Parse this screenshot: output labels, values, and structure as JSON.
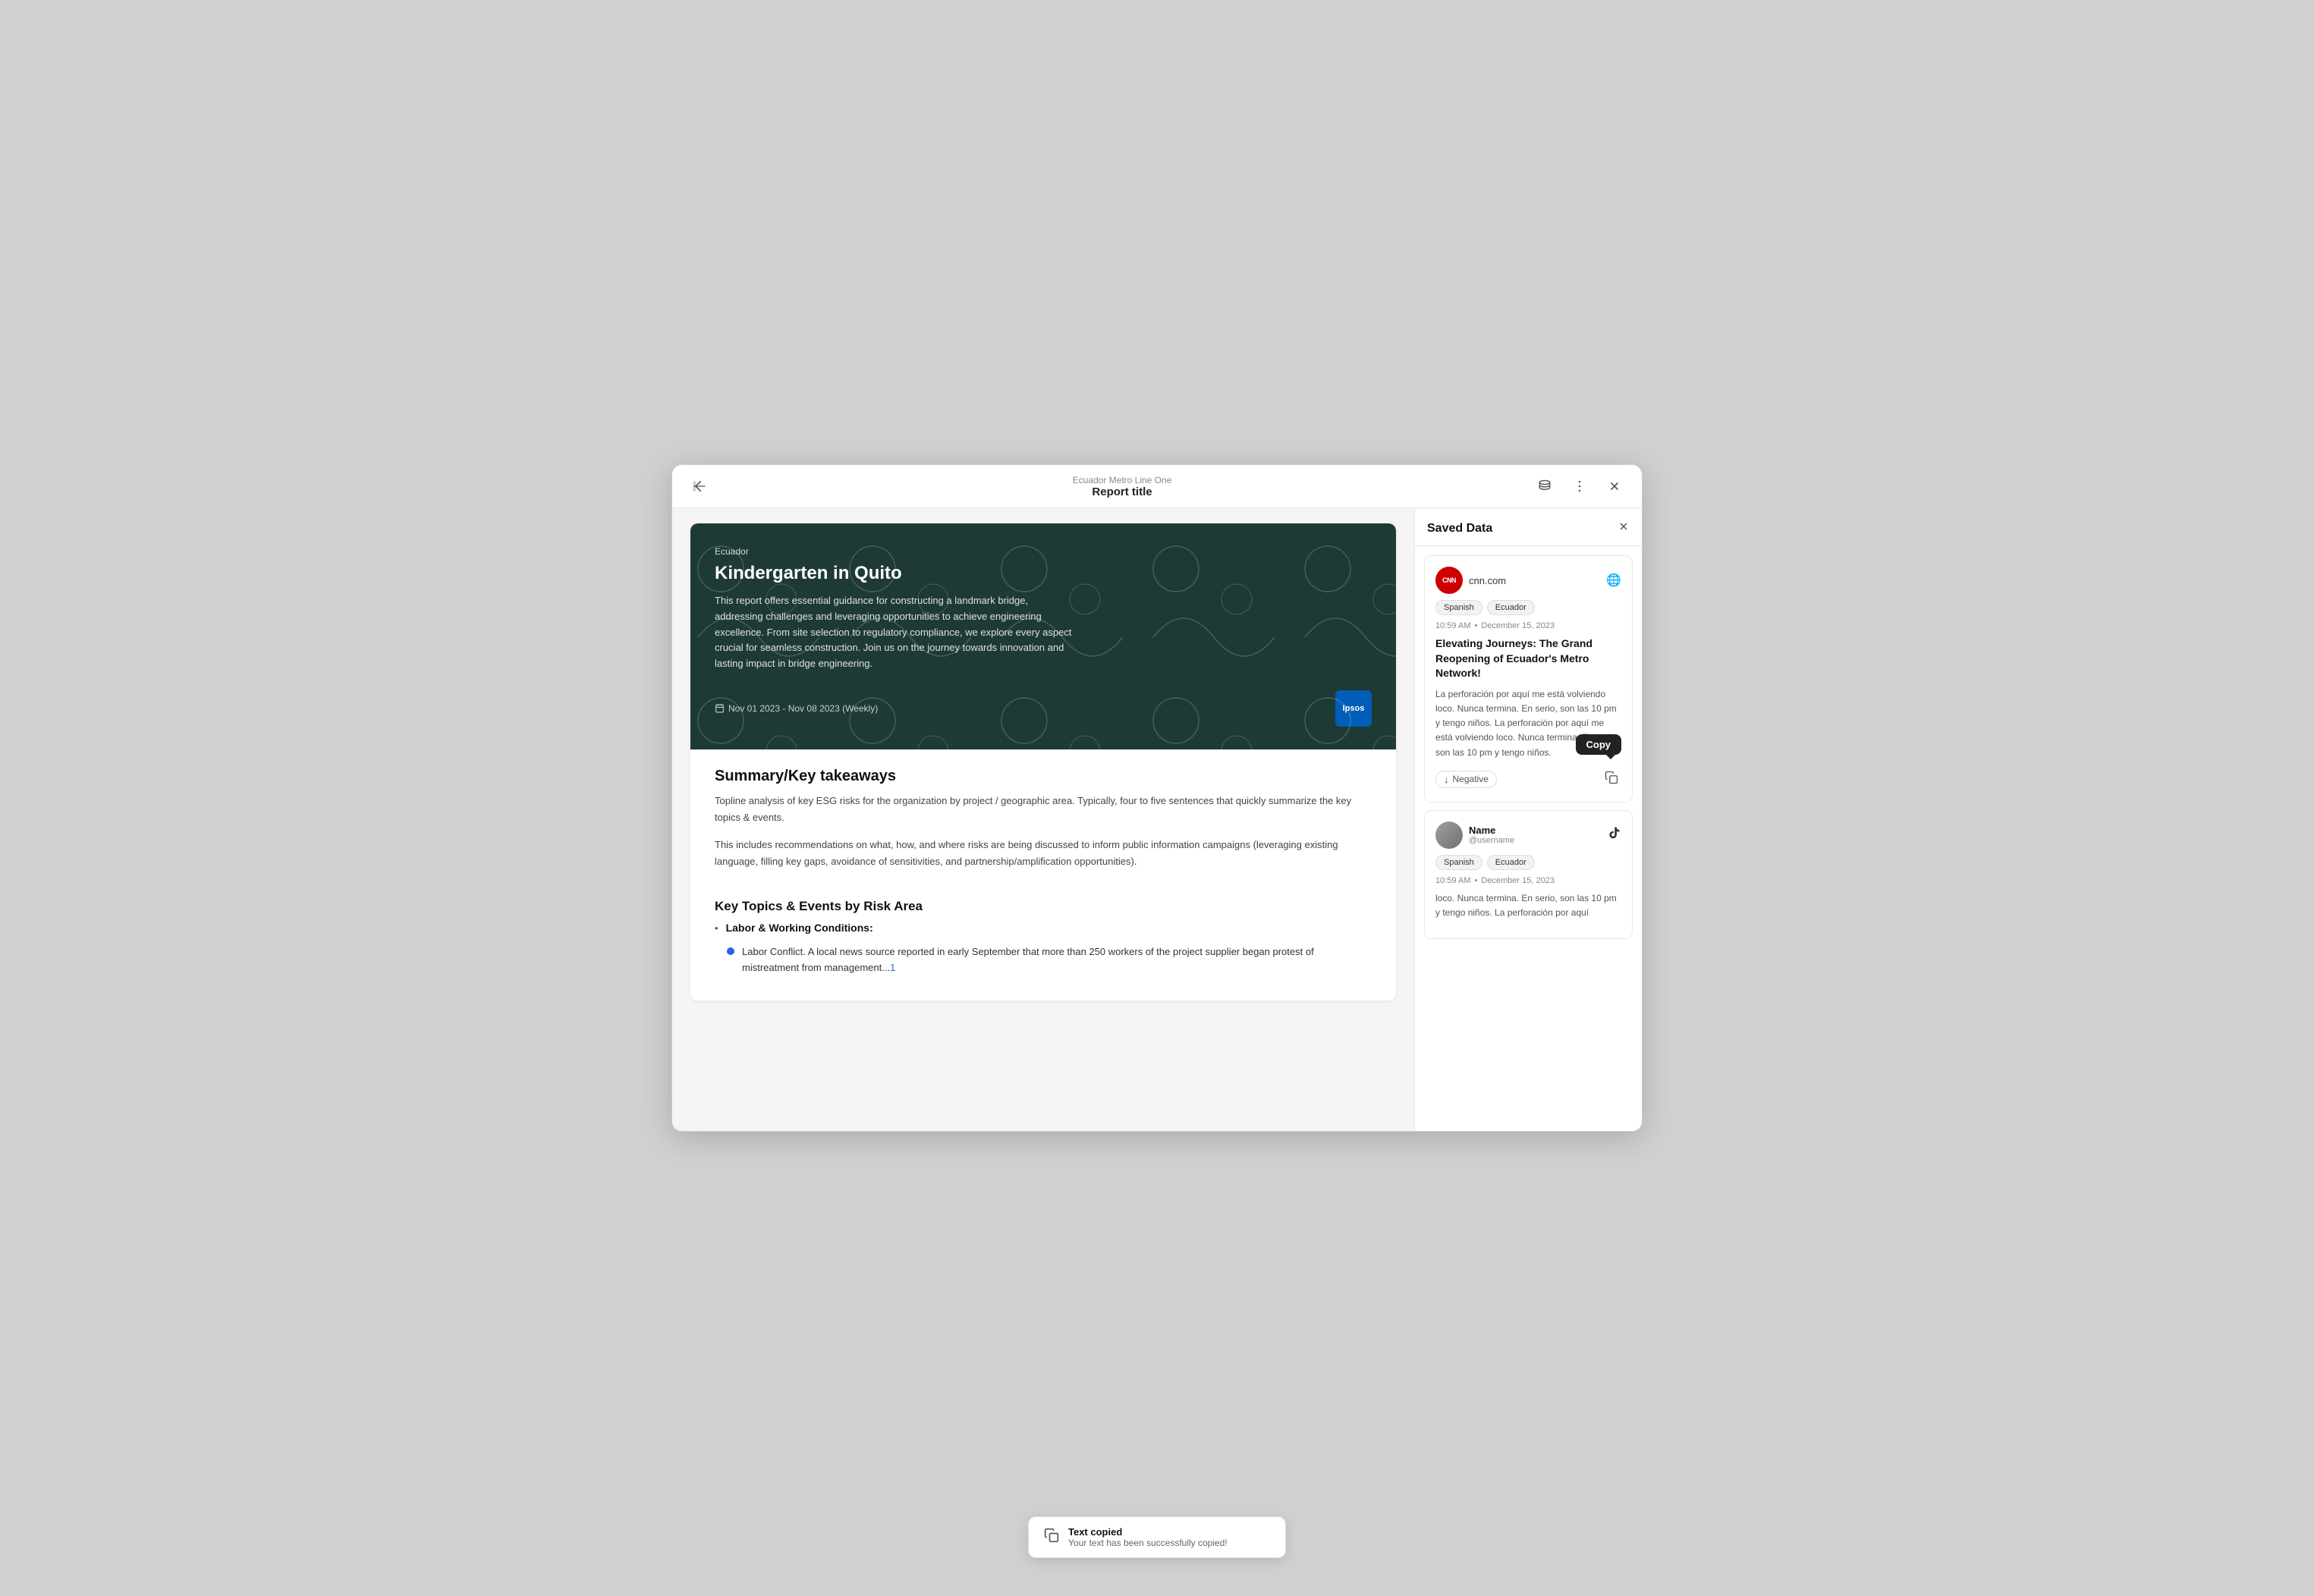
{
  "header": {
    "breadcrumb": "Ecuador Metro Line One",
    "title": "Report title",
    "back_icon": "←",
    "db_icon": "🗄",
    "more_icon": "⋯",
    "close_icon": "✕"
  },
  "doc": {
    "hero": {
      "region": "Ecuador",
      "title": "Kindergarten in Quito",
      "description": "This report offers essential guidance for constructing a landmark bridge, addressing challenges and leveraging opportunities to achieve engineering excellence. From site selection to regulatory compliance, we explore every aspect crucial for seamless construction. Join us on the journey towards innovation and lasting impact in bridge engineering.",
      "date": "Nov 01 2023 - Nov 08 2023 (Weekly)",
      "logo": "Ipsos"
    },
    "sections": [
      {
        "id": "summary",
        "title": "Summary/Key takeaways",
        "paragraphs": [
          "Topline analysis of key ESG risks for the organization by project / geographic area. Typically, four to five sentences that quickly summarize the key topics & events.",
          "This includes recommendations on what, how, and where risks are being discussed to inform public information campaigns (leveraging existing language, filling key gaps, avoidance of sensitivities, and partnership/amplification opportunities)."
        ]
      },
      {
        "id": "key-topics",
        "title": "Key Topics & Events by Risk Area",
        "subsections": [
          {
            "title": "Labor & Working Conditions:",
            "bullets": [
              {
                "text": "Labor Conflict. A local news source reported in early September that more than 250 workers of the project supplier began protest of mistreatment from management...",
                "link": "1",
                "has_dot": true
              }
            ]
          }
        ]
      }
    ]
  },
  "saved_panel": {
    "title": "Saved Data",
    "close_icon": "✕",
    "cards": [
      {
        "id": "card-1",
        "source": "cnn.com",
        "source_icon": "CNN",
        "platform_icon": "🌐",
        "tags": [
          "Spanish",
          "Ecuador"
        ],
        "time": "10:59 AM",
        "date": "December 15, 2023",
        "headline": "Elevating Journeys: The Grand Reopening of Ecuador's Metro Network!",
        "body": "La perforación por aquí me está volviendo loco. Nunca termina. En serio, son las 10 pm y tengo niños. La perforación por aquí me está volviendo loco. Nunca termina. En serio, son las 10 pm y tengo niños.",
        "sentiment": "Negative",
        "sentiment_direction": "↓",
        "copy_label": "Copy",
        "show_copy_tooltip": true
      },
      {
        "id": "card-2",
        "source": "Name",
        "source_handle": "@username",
        "platform_icon": "TikTok",
        "tags": [
          "Spanish",
          "Ecuador"
        ],
        "time": "10:59 AM",
        "date": "December 15, 2023",
        "body_preview": "loco. Nunca termina. En serio, son las 10 pm y tengo niños. La perforación por aquí",
        "is_user": true
      }
    ]
  },
  "toast": {
    "icon": "📋",
    "title": "Text copied",
    "subtitle": "Your text has been successfully copied!"
  }
}
